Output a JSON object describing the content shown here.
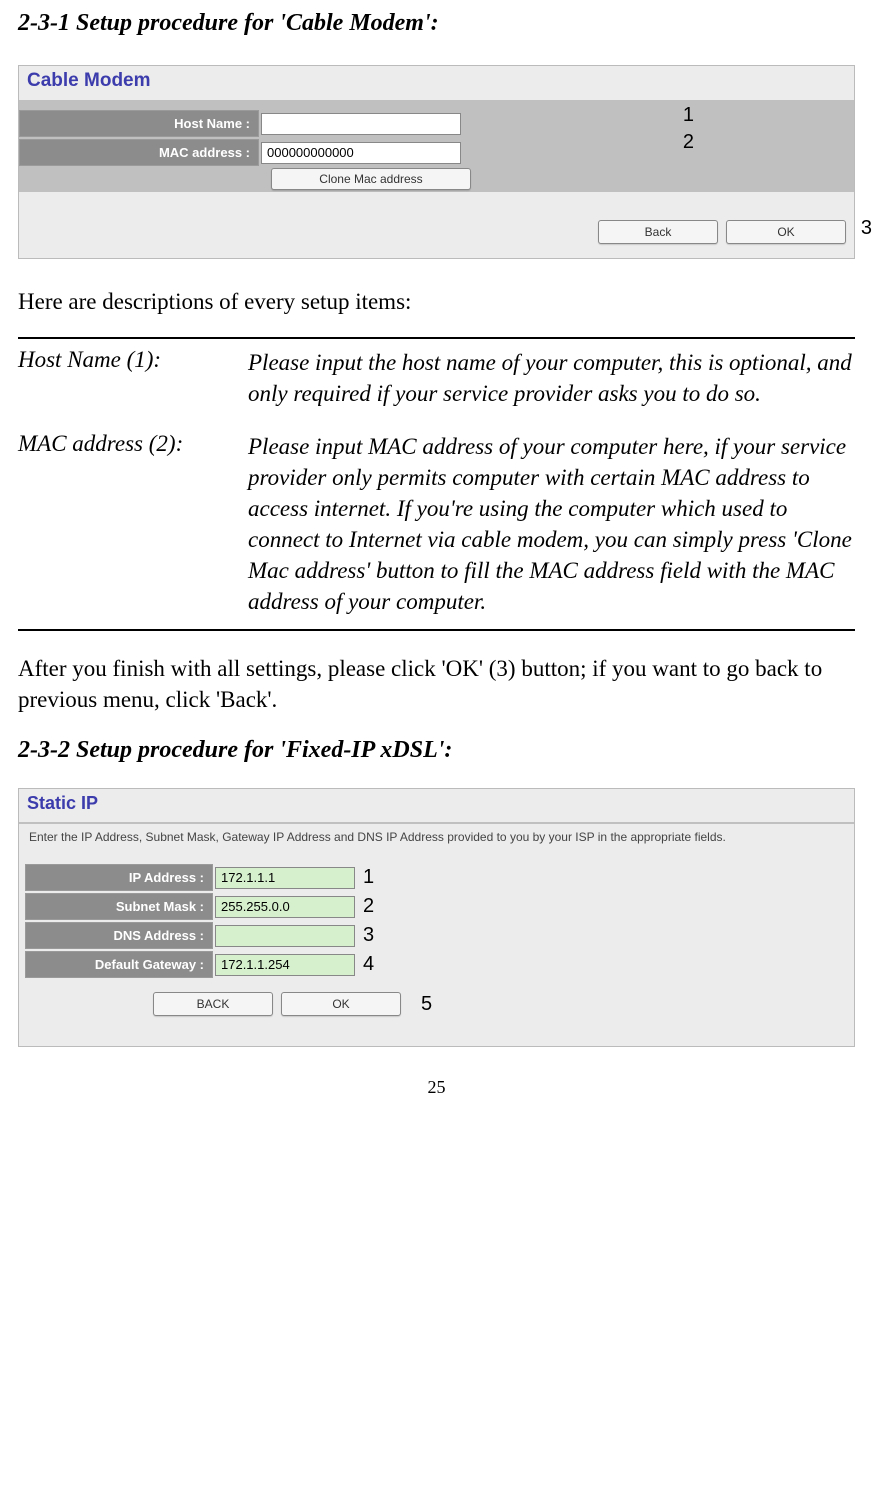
{
  "section1": {
    "title": "2-3-1 Setup procedure for 'Cable Modem':",
    "panel": {
      "heading": "Cable Modem",
      "rows": [
        {
          "label": "Host Name :",
          "callout": "1",
          "value": ""
        },
        {
          "label": "MAC address :",
          "callout": "2",
          "value": "000000000000"
        }
      ],
      "clone_btn": "Clone Mac address",
      "back_btn": "Back",
      "ok_btn": "OK",
      "btn_callout": "3"
    },
    "intro": "Here are descriptions of every setup items:",
    "desc": [
      {
        "term": "Host Name (1):",
        "def": "Please input the host name of your computer, this is optional, and only required if your service provider asks you to do so."
      },
      {
        "term": "MAC address (2):",
        "def": "Please input MAC address of your computer here, if your service provider only permits computer with certain MAC address to access internet. If you're using the computer which used to connect to Internet via cable modem, you can simply press 'Clone Mac address' button to fill the MAC address field with the MAC address of your computer."
      }
    ],
    "after": "After you finish with all settings, please click 'OK' (3) button; if you want to go back to previous menu, click 'Back'."
  },
  "section2": {
    "title": "2-3-2 Setup procedure for 'Fixed-IP xDSL':",
    "panel": {
      "heading": "Static IP",
      "desc": "Enter the IP Address, Subnet Mask, Gateway IP Address and DNS IP Address provided to you by your ISP in the appropriate fields.",
      "rows": [
        {
          "label": "IP Address :",
          "value": "172.1.1.1",
          "callout": "1"
        },
        {
          "label": "Subnet Mask :",
          "value": "255.255.0.0",
          "callout": "2"
        },
        {
          "label": "DNS Address :",
          "value": "",
          "callout": "3"
        },
        {
          "label": "Default Gateway :",
          "value": "172.1.1.254",
          "callout": "4"
        }
      ],
      "back_btn": "BACK",
      "ok_btn": "OK",
      "btn_callout": "5"
    }
  },
  "page_number": "25"
}
